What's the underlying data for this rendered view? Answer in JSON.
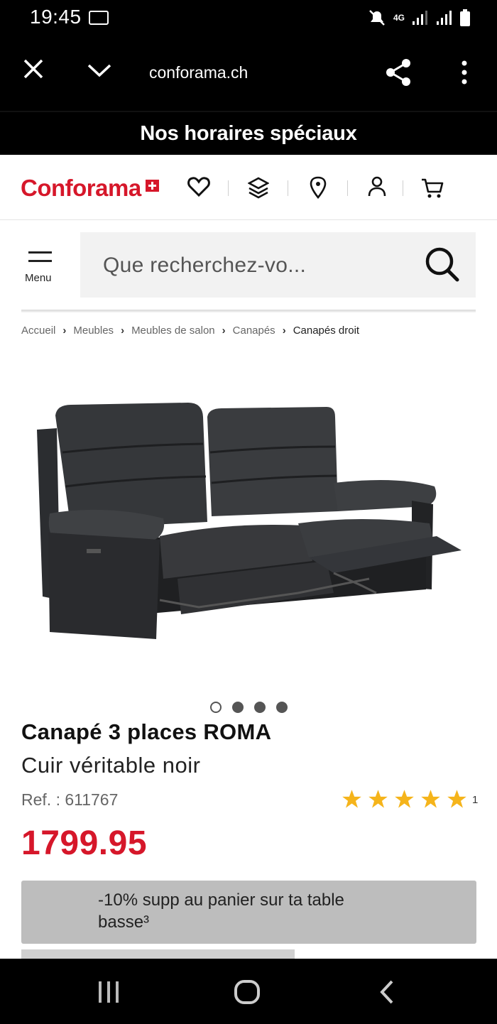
{
  "status_bar": {
    "time": "19:45",
    "network": "4G"
  },
  "browser": {
    "url": "conforama.ch"
  },
  "promo_banner": {
    "text": "Nos horaires spéciaux"
  },
  "header": {
    "logo": "Conforama"
  },
  "menu": {
    "label": "Menu"
  },
  "search": {
    "placeholder": "Que recherchez-vo..."
  },
  "breadcrumb": {
    "items": [
      "Accueil",
      "Meubles",
      "Meubles de salon",
      "Canapés",
      "Canapés droit"
    ]
  },
  "carousel": {
    "total": 4,
    "active_index": 0
  },
  "product": {
    "title": "Canapé 3 places ROMA",
    "subtitle": "Cuir véritable noir",
    "ref": "Ref. : 611767",
    "rating_stars": 5,
    "rating_count": "1",
    "price": "1799.95",
    "promo": "-10% supp au panier sur ta table basse³"
  },
  "colors": {
    "brand_red": "#d6172a",
    "star_yellow": "#f5b41b"
  }
}
